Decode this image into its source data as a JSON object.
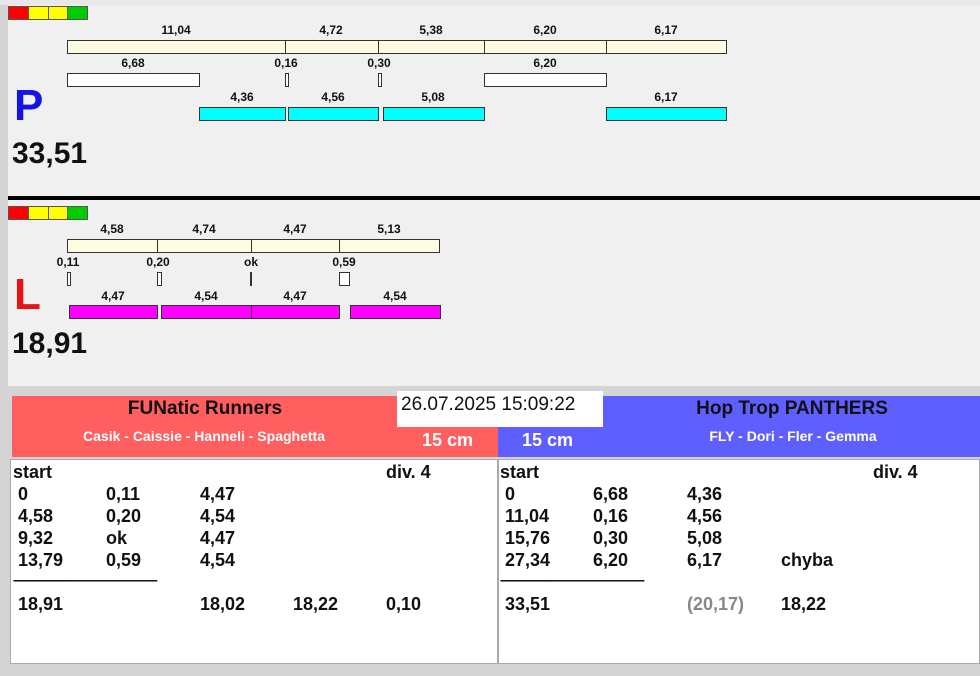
{
  "colors": {
    "team_left": "#ff5f5f",
    "team_right": "#5f5fff",
    "bar_cyan": "#00ffff",
    "bar_magenta": "#ff00ff"
  },
  "indicator_lights": [
    "red",
    "yellow",
    "yellow",
    "green"
  ],
  "p_panel": {
    "letter": "P",
    "total": "33,51",
    "row1": [
      "11,04",
      "4,72",
      "5,38",
      "6,20",
      "6,17"
    ],
    "row2": [
      "6,68",
      "0,16",
      "0,30",
      "6,20"
    ],
    "row3": [
      "4,36",
      "4,56",
      "5,08",
      "6,17"
    ]
  },
  "l_panel": {
    "letter": "L",
    "total": "18,91",
    "row1": [
      "4,58",
      "4,74",
      "4,47",
      "5,13"
    ],
    "row2": [
      "0,11",
      "0,20",
      "ok",
      "0,59"
    ],
    "row3": [
      "4,47",
      "4,54",
      "4,47",
      "4,54"
    ]
  },
  "datetime": "26.07.2025 15:09:22",
  "left_team": {
    "name": "FUNatic Runners",
    "members": "Casik - Caissie - Hanneli - Spaghetta",
    "distance": "15 cm",
    "start": "start",
    "division": "div. 4",
    "rows": [
      [
        "0",
        "0,11",
        "4,47"
      ],
      [
        "4,58",
        "0,20",
        "4,54"
      ],
      [
        "9,32",
        "ok",
        "4,47"
      ],
      [
        "13,79",
        "0,59",
        "4,54"
      ]
    ],
    "separator": "------------------------------------------------",
    "summary": [
      "18,91",
      "18,02",
      "18,22",
      "0,10"
    ]
  },
  "right_team": {
    "name": "Hop Trop PANTHERS",
    "members": "FLY - Dori - Fler - Gemma",
    "distance": "15 cm",
    "start": "start",
    "division": "div. 4",
    "rows": [
      [
        "0",
        "6,68",
        "4,36",
        ""
      ],
      [
        "11,04",
        "0,16",
        "4,56",
        ""
      ],
      [
        "15,76",
        "0,30",
        "5,08",
        ""
      ],
      [
        "27,34",
        "6,20",
        "6,17",
        "chyba"
      ]
    ],
    "separator": "------------------------------------------------",
    "summary": [
      "33,51",
      "(20,17)",
      "18,22"
    ]
  }
}
